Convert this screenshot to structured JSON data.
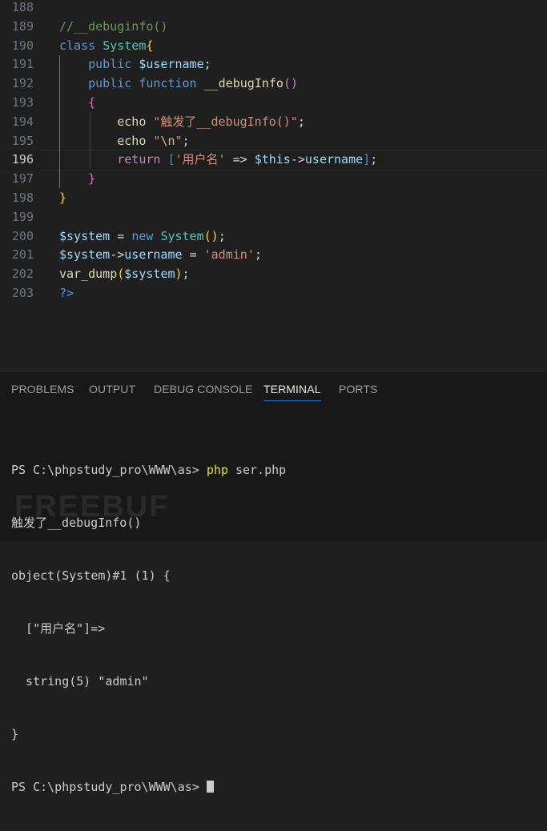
{
  "editor": {
    "lines": [
      {
        "n": "188",
        "tokens": []
      },
      {
        "n": "189",
        "tokens": [
          {
            "c": "t-comment",
            "t": "//__debuginfo()"
          }
        ]
      },
      {
        "n": "190",
        "tokens": [
          {
            "c": "t-kw",
            "t": "class"
          },
          {
            "c": "",
            "t": " "
          },
          {
            "c": "t-class",
            "t": "System"
          },
          {
            "c": "t-br1",
            "t": "{"
          }
        ]
      },
      {
        "n": "191",
        "tokens": [
          {
            "c": "",
            "t": "    "
          },
          {
            "c": "t-kw",
            "t": "public"
          },
          {
            "c": "",
            "t": " "
          },
          {
            "c": "t-var",
            "t": "$username"
          },
          {
            "c": "t-op",
            "t": ";"
          }
        ]
      },
      {
        "n": "192",
        "tokens": [
          {
            "c": "",
            "t": "    "
          },
          {
            "c": "t-kw",
            "t": "public"
          },
          {
            "c": "",
            "t": " "
          },
          {
            "c": "t-kw",
            "t": "function"
          },
          {
            "c": "",
            "t": " "
          },
          {
            "c": "t-fn",
            "t": "__debugInfo"
          },
          {
            "c": "t-br2",
            "t": "()"
          }
        ]
      },
      {
        "n": "193",
        "tokens": [
          {
            "c": "",
            "t": "    "
          },
          {
            "c": "t-br2",
            "t": "{"
          }
        ]
      },
      {
        "n": "194",
        "tokens": [
          {
            "c": "",
            "t": "        "
          },
          {
            "c": "t-fn",
            "t": "echo"
          },
          {
            "c": "",
            "t": " "
          },
          {
            "c": "t-str",
            "t": "\"触发了__debugInfo()\""
          },
          {
            "c": "t-op",
            "t": ";"
          }
        ]
      },
      {
        "n": "195",
        "tokens": [
          {
            "c": "",
            "t": "        "
          },
          {
            "c": "t-fn",
            "t": "echo"
          },
          {
            "c": "",
            "t": " "
          },
          {
            "c": "t-str",
            "t": "\""
          },
          {
            "c": "t-esc",
            "t": "\\n"
          },
          {
            "c": "t-str",
            "t": "\""
          },
          {
            "c": "t-op",
            "t": ";"
          }
        ]
      },
      {
        "n": "196",
        "tokens": [
          {
            "c": "",
            "t": "        "
          },
          {
            "c": "t-ctrl",
            "t": "return"
          },
          {
            "c": "",
            "t": " "
          },
          {
            "c": "t-br3",
            "t": "["
          },
          {
            "c": "t-str",
            "t": "'用户名'"
          },
          {
            "c": "",
            "t": " "
          },
          {
            "c": "t-op",
            "t": "=>"
          },
          {
            "c": "",
            "t": " "
          },
          {
            "c": "t-var",
            "t": "$this"
          },
          {
            "c": "t-op",
            "t": "->"
          },
          {
            "c": "t-var",
            "t": "username"
          },
          {
            "c": "t-br3",
            "t": "]"
          },
          {
            "c": "t-op",
            "t": ";"
          }
        ]
      },
      {
        "n": "197",
        "tokens": [
          {
            "c": "",
            "t": "    "
          },
          {
            "c": "t-br2",
            "t": "}"
          }
        ]
      },
      {
        "n": "198",
        "tokens": [
          {
            "c": "t-br1",
            "t": "}"
          }
        ]
      },
      {
        "n": "199",
        "tokens": []
      },
      {
        "n": "200",
        "tokens": [
          {
            "c": "t-var",
            "t": "$system"
          },
          {
            "c": "",
            "t": " "
          },
          {
            "c": "t-op",
            "t": "="
          },
          {
            "c": "",
            "t": " "
          },
          {
            "c": "t-kw",
            "t": "new"
          },
          {
            "c": "",
            "t": " "
          },
          {
            "c": "t-class",
            "t": "System"
          },
          {
            "c": "t-br1",
            "t": "()"
          },
          {
            "c": "t-op",
            "t": ";"
          }
        ]
      },
      {
        "n": "201",
        "tokens": [
          {
            "c": "t-var",
            "t": "$system"
          },
          {
            "c": "t-op",
            "t": "->"
          },
          {
            "c": "t-var",
            "t": "username"
          },
          {
            "c": "",
            "t": " "
          },
          {
            "c": "t-op",
            "t": "="
          },
          {
            "c": "",
            "t": " "
          },
          {
            "c": "t-str",
            "t": "'admin'"
          },
          {
            "c": "t-op",
            "t": ";"
          }
        ]
      },
      {
        "n": "202",
        "tokens": [
          {
            "c": "t-fn",
            "t": "var_dump"
          },
          {
            "c": "t-br1",
            "t": "("
          },
          {
            "c": "t-var",
            "t": "$system"
          },
          {
            "c": "t-br1",
            "t": ")"
          },
          {
            "c": "t-op",
            "t": ";"
          }
        ]
      },
      {
        "n": "203",
        "tokens": [
          {
            "c": "t-kw",
            "t": "?>"
          }
        ]
      }
    ],
    "current_line": "196"
  },
  "panel": {
    "tabs": [
      {
        "id": "problems",
        "label": "PROBLEMS",
        "active": false
      },
      {
        "id": "output",
        "label": "OUTPUT",
        "active": false
      },
      {
        "id": "debug-console",
        "label": "DEBUG CONSOLE",
        "active": false
      },
      {
        "id": "terminal",
        "label": "TERMINAL",
        "active": true
      },
      {
        "id": "ports",
        "label": "PORTS",
        "active": false
      }
    ],
    "terminal": {
      "prompt": "PS C:\\phpstudy_pro\\WWW\\as> ",
      "command_name": "php",
      "command_args": " ser.php",
      "output": [
        "触发了__debugInfo()",
        "object(System)#1 (1) {",
        "  [\"用户名\"]=>",
        "  string(5) \"admin\"",
        "}"
      ],
      "final_prompt": "PS C:\\phpstudy_pro\\WWW\\as> "
    }
  },
  "colors": {
    "editor_bg": "#1f1f1f",
    "panel_bg": "#181818",
    "accent": "#0078d4"
  }
}
